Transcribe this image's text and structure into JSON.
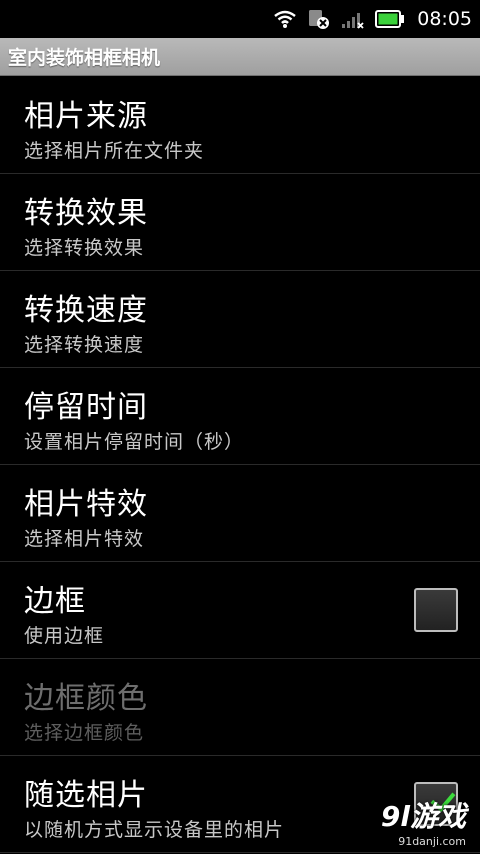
{
  "status_bar": {
    "time": "08:05",
    "icons": [
      "wifi-icon",
      "no-sim-icon",
      "signal-icon",
      "battery-icon"
    ],
    "battery_color": "#3bd13b"
  },
  "app": {
    "title": "室内装饰相框相机"
  },
  "preferences": [
    {
      "title": "相片来源",
      "summary": "选择相片所在文件夹"
    },
    {
      "title": "转换效果",
      "summary": "选择转换效果"
    },
    {
      "title": "转换速度",
      "summary": "选择转换速度"
    },
    {
      "title": "停留时间",
      "summary": "设置相片停留时间（秒）"
    },
    {
      "title": "相片特效",
      "summary": "选择相片特效"
    },
    {
      "title": "边框",
      "summary": "使用边框",
      "checkbox": "unchecked"
    },
    {
      "title": "边框颜色",
      "summary": "选择边框颜色",
      "enabled": false
    },
    {
      "title": "随选相片",
      "summary": "以随机方式显示设备里的相片",
      "checkbox": "checked"
    }
  ],
  "watermark": {
    "logo": "9l游戏",
    "url": "91danji.com"
  }
}
